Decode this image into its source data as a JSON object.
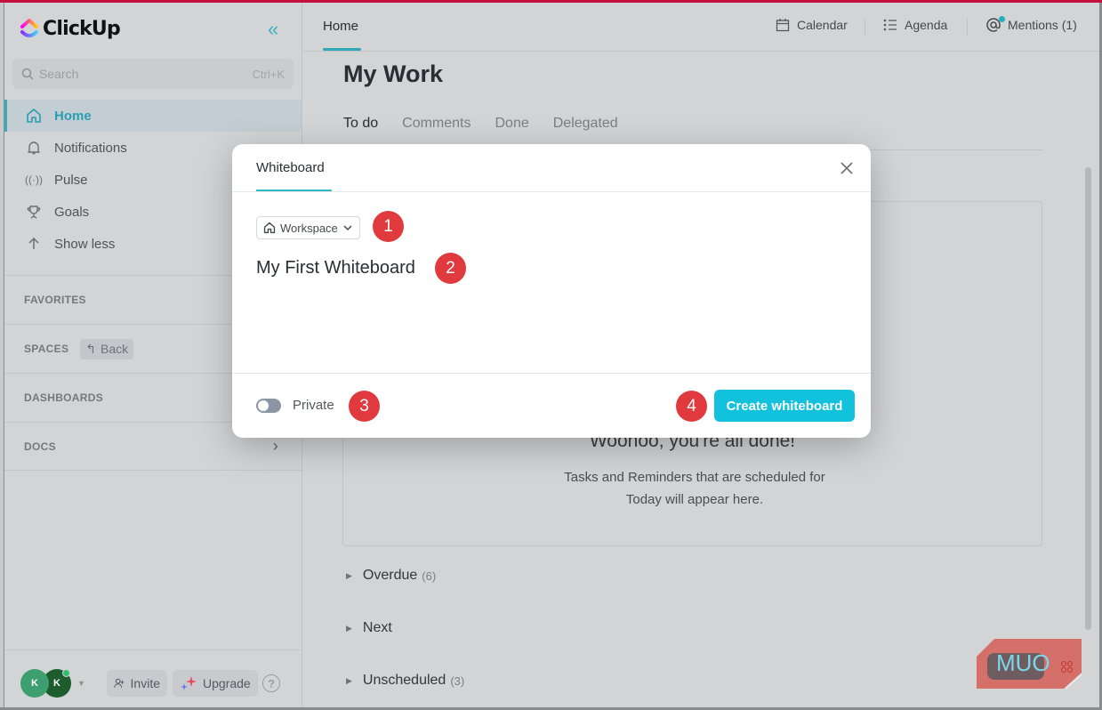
{
  "app": {
    "name": "ClickUp"
  },
  "sidebar": {
    "search": {
      "placeholder": "Search",
      "shortcut": "Ctrl+K"
    },
    "nav_items": [
      {
        "label": "Home",
        "icon": "home-icon",
        "active": true
      },
      {
        "label": "Notifications",
        "icon": "bell-icon",
        "active": false
      },
      {
        "label": "Pulse",
        "icon": "pulse-icon",
        "active": false
      },
      {
        "label": "Goals",
        "icon": "trophy-icon",
        "active": false
      },
      {
        "label": "Show less",
        "icon": "arrow-up-icon",
        "active": false
      }
    ],
    "sections": {
      "favorites": "FAVORITES",
      "spaces": "SPACES",
      "spaces_back": "Back",
      "dashboards": "DASHBOARDS",
      "docs": "DOCS"
    },
    "footer": {
      "avatars": [
        {
          "initial": "K",
          "color": "#3d9e6f"
        },
        {
          "initial": "K",
          "color": "#1d5c2c"
        }
      ],
      "invite_label": "Invite",
      "upgrade_label": "Upgrade",
      "help_label": "?"
    }
  },
  "header": {
    "home_tab": "Home",
    "calendar_label": "Calendar",
    "agenda_label": "Agenda",
    "mentions_label": "Mentions (1)"
  },
  "main": {
    "title": "My Work",
    "tabs": [
      {
        "label": "To do",
        "active": true
      },
      {
        "label": "Comments",
        "active": false
      },
      {
        "label": "Done",
        "active": false
      },
      {
        "label": "Delegated",
        "active": false
      }
    ],
    "empty_state": {
      "title": "Woohoo, you're all done!",
      "subtitle": "Tasks and Reminders that are scheduled for Today will appear here."
    },
    "groups": [
      {
        "label": "Overdue",
        "count": "(6)"
      },
      {
        "label": "Next",
        "count": ""
      },
      {
        "label": "Unscheduled",
        "count": "(3)"
      }
    ]
  },
  "modal": {
    "tab_label": "Whiteboard",
    "location_label": "Workspace",
    "whiteboard_name": "My First Whiteboard",
    "private_label": "Private",
    "private_enabled": false,
    "create_button": "Create whiteboard",
    "step_badges": [
      "1",
      "2",
      "3",
      "4"
    ]
  },
  "watermark": {
    "text": "MUO"
  },
  "colors": {
    "accent": "#2fb9c8",
    "primary_button": "#12c1db",
    "badge": "#e0393e",
    "top_bar": "#c4103d"
  }
}
